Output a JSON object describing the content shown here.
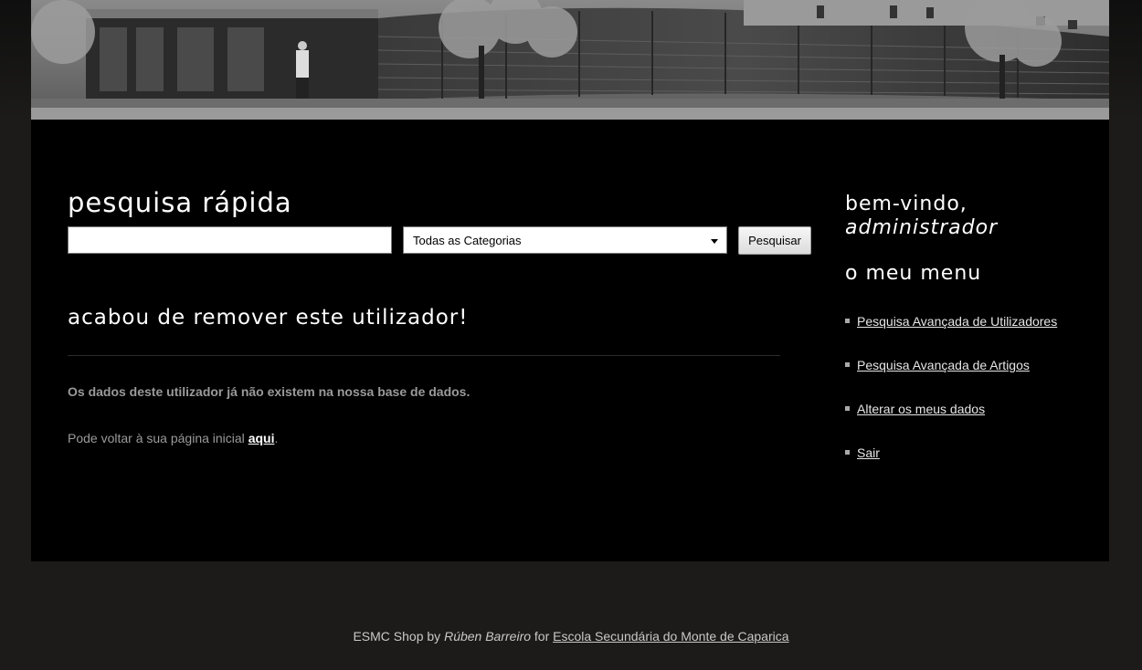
{
  "banner": {
    "alt": "Edifício da escola"
  },
  "search": {
    "title": "pesquisa rápida",
    "input_value": "",
    "category_selected": "Todas as Categorias",
    "button_label": "Pesquisar"
  },
  "main": {
    "heading": "acabou de remover este utilizador!",
    "message_bold": "Os dados deste utilizador já não existem na nossa base de dados.",
    "message_prefix": "Pode voltar à sua página inicial ",
    "message_link": "aqui",
    "message_suffix": "."
  },
  "sidebar": {
    "welcome": "bem-vindo,",
    "username": "administrador",
    "menu_title": "o meu menu",
    "items": [
      {
        "label": "Pesquisa Avançada de Utilizadores"
      },
      {
        "label": "Pesquisa Avançada de Artigos"
      },
      {
        "label": "Alterar os meus dados"
      },
      {
        "label": "Sair"
      }
    ]
  },
  "footer": {
    "site": "ESMC Shop by ",
    "author": "Rúben Barreiro",
    "for_text": " for ",
    "school_link": "Escola Secundária do Monte de Caparica"
  }
}
